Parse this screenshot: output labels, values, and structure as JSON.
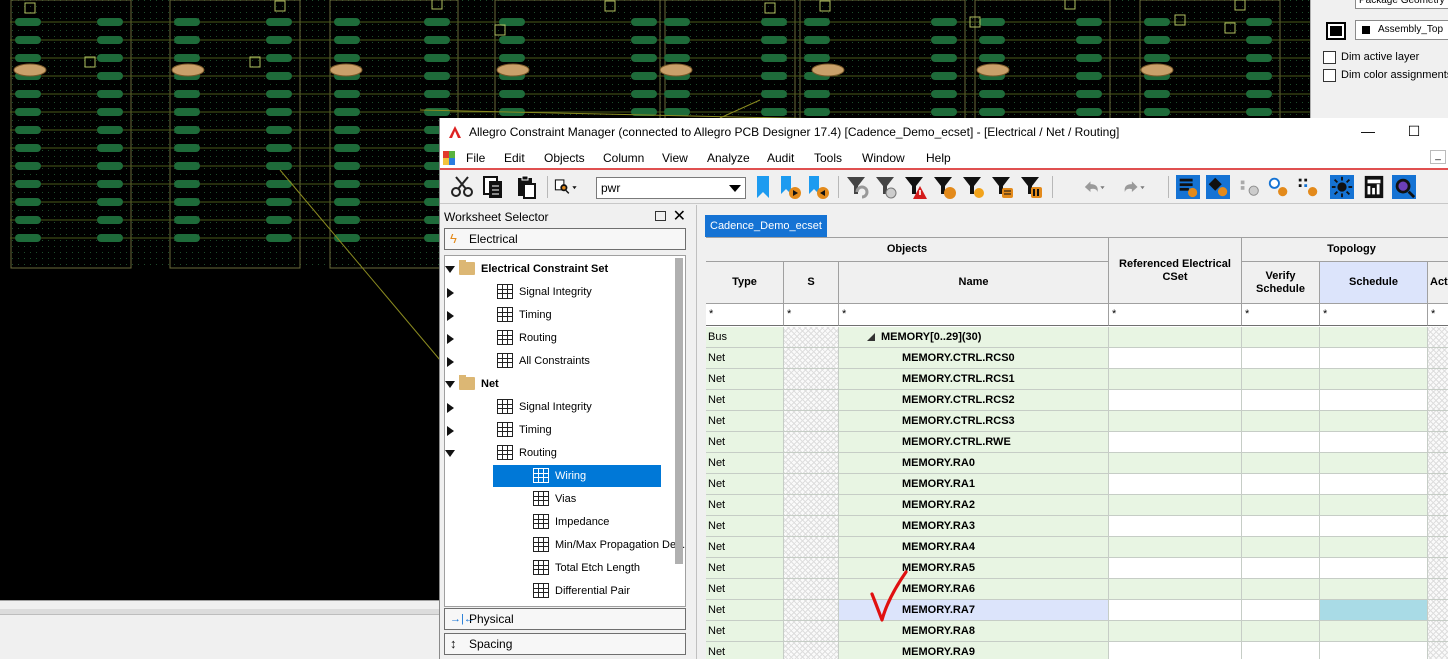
{
  "visibility_panel": {
    "package_select": "Package Geometry",
    "layer_select": "Assembly_Top",
    "dim_active_layer": "Dim active layer",
    "dim_color_assignments": "Dim color assignments"
  },
  "window": {
    "title": "Allegro Constraint Manager (connected to Allegro PCB Designer 17.4) [Cadence_Demo_ecset] - [Electrical / Net / Routing]",
    "min_glyph": "—",
    "max_glyph": "☐"
  },
  "menu": {
    "items": [
      "File",
      "Edit",
      "Objects",
      "Column",
      "View",
      "Analyze",
      "Audit",
      "Tools",
      "Window",
      "Help"
    ],
    "restore_glyph": "_"
  },
  "toolbar": {
    "filter_value": "pwr"
  },
  "worksheet_selector": {
    "title": "Worksheet Selector",
    "top_bar": "Electrical",
    "tree": [
      {
        "label": "Electrical Constraint Set",
        "level": 0,
        "kind": "folder",
        "state": "expanded",
        "bold": true
      },
      {
        "label": "Signal Integrity",
        "level": 1,
        "kind": "sheet",
        "state": "collapsed"
      },
      {
        "label": "Timing",
        "level": 1,
        "kind": "sheet",
        "state": "collapsed"
      },
      {
        "label": "Routing",
        "level": 1,
        "kind": "sheet",
        "state": "collapsed"
      },
      {
        "label": "All Constraints",
        "level": 1,
        "kind": "sheet",
        "state": "collapsed"
      },
      {
        "label": "Net",
        "level": 0,
        "kind": "folder",
        "state": "expanded",
        "bold": true
      },
      {
        "label": "Signal Integrity",
        "level": 1,
        "kind": "sheet",
        "state": "collapsed"
      },
      {
        "label": "Timing",
        "level": 1,
        "kind": "sheet",
        "state": "collapsed"
      },
      {
        "label": "Routing",
        "level": 1,
        "kind": "sheet",
        "state": "expanded"
      },
      {
        "label": "Wiring",
        "level": 2,
        "kind": "sheet",
        "state": "leaf",
        "selected": true
      },
      {
        "label": "Vias",
        "level": 2,
        "kind": "sheet",
        "state": "leaf"
      },
      {
        "label": "Impedance",
        "level": 2,
        "kind": "sheet",
        "state": "leaf"
      },
      {
        "label": "Min/Max Propagation De...",
        "level": 2,
        "kind": "sheet",
        "state": "leaf"
      },
      {
        "label": "Total Etch Length",
        "level": 2,
        "kind": "sheet",
        "state": "leaf"
      },
      {
        "label": "Differential Pair",
        "level": 2,
        "kind": "sheet",
        "state": "leaf"
      }
    ],
    "bottom_bars": [
      "Physical",
      "Spacing"
    ]
  },
  "worksheet": {
    "tab": "Cadence_Demo_ecset",
    "group_headers": {
      "objects": "Objects",
      "topology": "Topology"
    },
    "columns": {
      "type": "Type",
      "s": "S",
      "name": "Name",
      "ref_cset": "Referenced Electrical CSet",
      "verify": "Verify Schedule",
      "schedule": "Schedule",
      "actual": "Actual"
    },
    "filter_value": "*",
    "rows": [
      {
        "type": "Bus",
        "name": "MEMORY[0..29](30)",
        "bus": true
      },
      {
        "type": "Net",
        "name": "MEMORY.CTRL.RCS0"
      },
      {
        "type": "Net",
        "name": "MEMORY.CTRL.RCS1"
      },
      {
        "type": "Net",
        "name": "MEMORY.CTRL.RCS2"
      },
      {
        "type": "Net",
        "name": "MEMORY.CTRL.RCS3"
      },
      {
        "type": "Net",
        "name": "MEMORY.CTRL.RWE"
      },
      {
        "type": "Net",
        "name": "MEMORY.RA0"
      },
      {
        "type": "Net",
        "name": "MEMORY.RA1"
      },
      {
        "type": "Net",
        "name": "MEMORY.RA2"
      },
      {
        "type": "Net",
        "name": "MEMORY.RA3"
      },
      {
        "type": "Net",
        "name": "MEMORY.RA4"
      },
      {
        "type": "Net",
        "name": "MEMORY.RA5"
      },
      {
        "type": "Net",
        "name": "MEMORY.RA6"
      },
      {
        "type": "Net",
        "name": "MEMORY.RA7",
        "selected": true
      },
      {
        "type": "Net",
        "name": "MEMORY.RA8"
      },
      {
        "type": "Net",
        "name": "MEMORY.RA9"
      }
    ]
  },
  "colors": {
    "row_green": "#e8f5e3",
    "selected_blue": "#0078d7",
    "tab_blue": "#1573d4",
    "schedule_header": "#dce4fb",
    "annotation_red": "#e01010"
  }
}
